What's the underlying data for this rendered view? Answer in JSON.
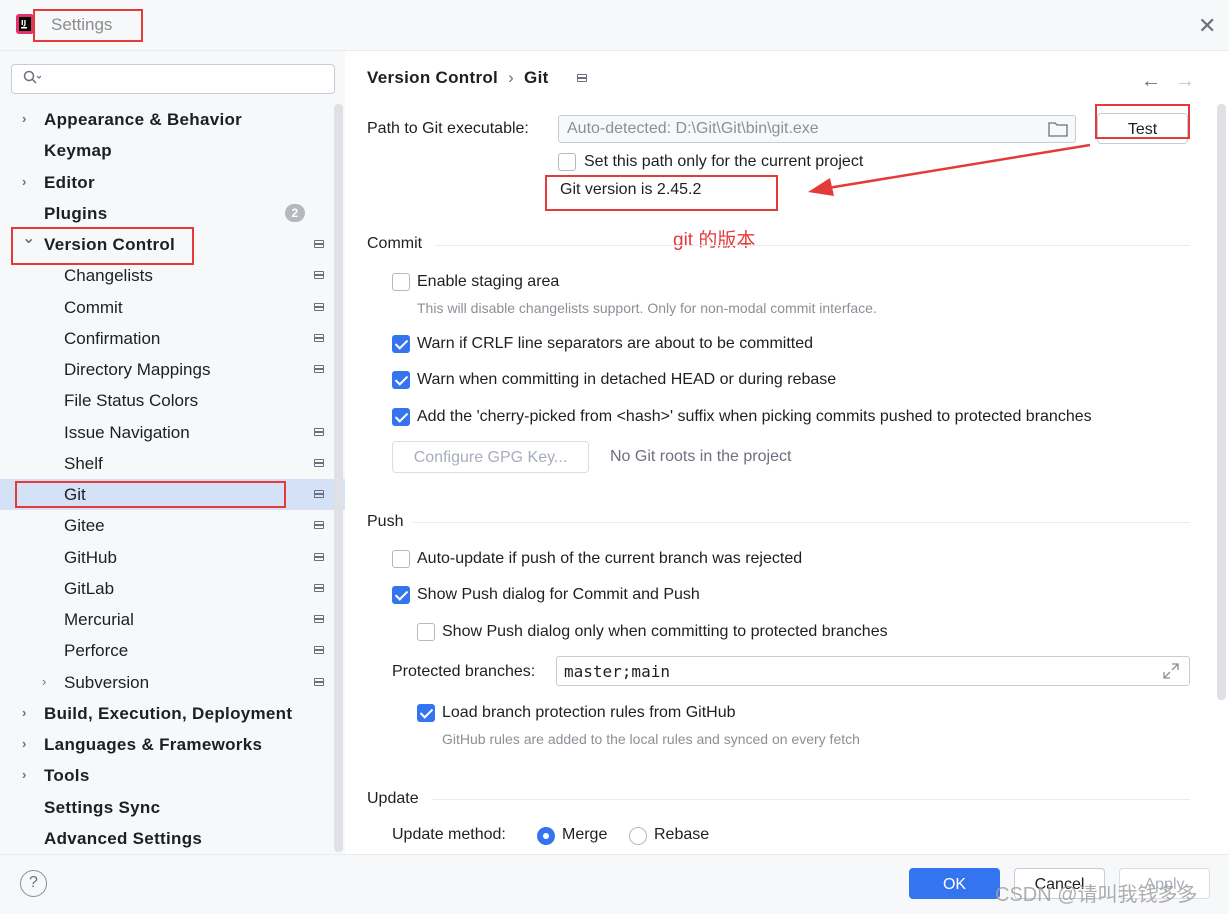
{
  "window": {
    "title": "Settings",
    "close_icon": "close-icon"
  },
  "search": {
    "placeholder": "",
    "icon": "search-icon"
  },
  "sidebar": {
    "items": [
      {
        "label": "Appearance & Behavior",
        "bold": true,
        "expandable": true
      },
      {
        "label": "Keymap",
        "bold": true
      },
      {
        "label": "Editor",
        "bold": true,
        "expandable": true
      },
      {
        "label": "Plugins",
        "bold": true,
        "badge": "2"
      },
      {
        "label": "Version Control",
        "bold": true,
        "expanded": true
      },
      {
        "label": "Changelists"
      },
      {
        "label": "Commit"
      },
      {
        "label": "Confirmation"
      },
      {
        "label": "Directory Mappings"
      },
      {
        "label": "File Status Colors"
      },
      {
        "label": "Issue Navigation"
      },
      {
        "label": "Shelf"
      },
      {
        "label": "Git",
        "selected": true
      },
      {
        "label": "Gitee"
      },
      {
        "label": "GitHub"
      },
      {
        "label": "GitLab"
      },
      {
        "label": "Mercurial"
      },
      {
        "label": "Perforce"
      },
      {
        "label": "Subversion",
        "expandable": true
      },
      {
        "label": "Build, Execution, Deployment",
        "bold": true,
        "expandable": true
      },
      {
        "label": "Languages & Frameworks",
        "bold": true,
        "expandable": true
      },
      {
        "label": "Tools",
        "bold": true,
        "expandable": true
      },
      {
        "label": "Settings Sync",
        "bold": true
      },
      {
        "label": "Advanced Settings",
        "bold": true
      }
    ]
  },
  "breadcrumb": {
    "parent": "Version Control",
    "separator": "›",
    "current": "Git"
  },
  "nav": {
    "back": "←",
    "forward": "→"
  },
  "git_path": {
    "label": "Path to Git executable:",
    "value": "Auto-detected: D:\\Git\\Git\\bin\\git.exe",
    "test_button": "Test",
    "project_only_label": "Set this path only for the current project",
    "project_only_checked": false,
    "version_text": "Git version is 2.45.2",
    "annotation": "git 的版本"
  },
  "commit": {
    "title": "Commit",
    "staging": {
      "label": "Enable staging area",
      "checked": false,
      "hint": "This will disable changelists support. Only for non-modal commit interface."
    },
    "crlf": {
      "label": "Warn if CRLF line separators are about to be committed",
      "checked": true
    },
    "detached": {
      "label": "Warn when committing in detached HEAD or during rebase",
      "checked": true
    },
    "cherry": {
      "label": "Add the 'cherry-picked from <hash>' suffix when picking commits pushed to protected branches",
      "checked": true
    },
    "gpg_button": "Configure GPG Key...",
    "gpg_note": "No Git roots in the project"
  },
  "push": {
    "title": "Push",
    "auto_update": {
      "label": "Auto-update if push of the current branch was rejected",
      "checked": false
    },
    "show_dialog": {
      "label": "Show Push dialog for Commit and Push",
      "checked": true
    },
    "protected_only": {
      "label": "Show Push dialog only when committing to protected branches",
      "checked": false
    },
    "protected_label": "Protected branches:",
    "protected_value": "master;main",
    "load_rules": {
      "label": "Load branch protection rules from GitHub",
      "checked": true,
      "hint": "GitHub rules are added to the local rules and synced on every fetch"
    }
  },
  "update": {
    "title": "Update",
    "method_label": "Update method:",
    "options": [
      "Merge",
      "Rebase"
    ],
    "selected": "Merge"
  },
  "footer": {
    "help": "?",
    "ok": "OK",
    "cancel": "Cancel",
    "apply": "Apply"
  },
  "watermark": "CSDN @请叫我钱多多",
  "colors": {
    "accent": "#3574f0",
    "annotation": "#e53a3a",
    "selection": "#d5e1f7"
  }
}
